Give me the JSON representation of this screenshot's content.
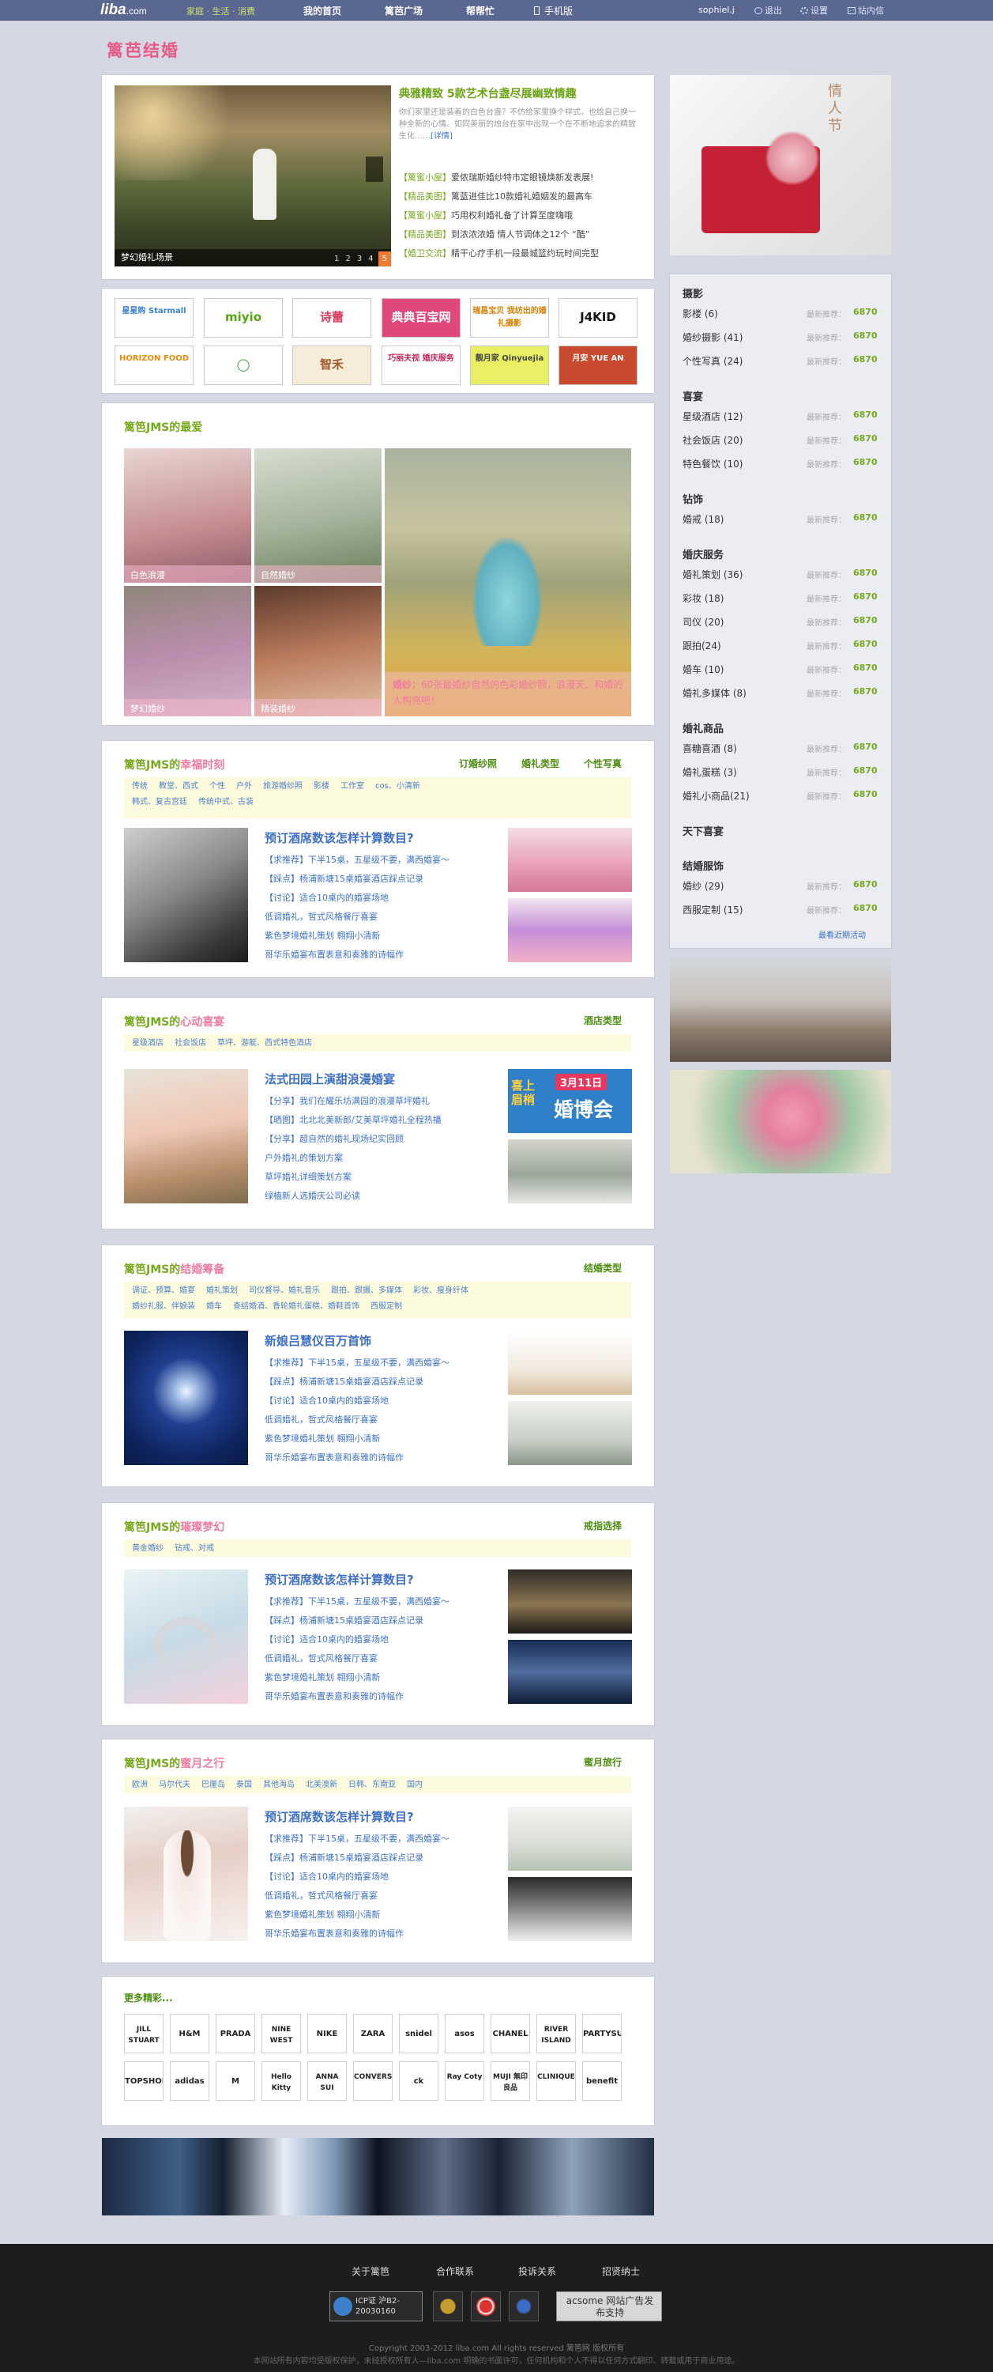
{
  "topbar": {
    "logo": "liba",
    "logo_suffix": ".com",
    "slogan": "家庭 · 生活 · 消费",
    "nav": [
      "我的首页",
      "篱芭广场",
      "帮帮忙",
      "手机版"
    ],
    "username": "sophiel.j",
    "logout": "退出",
    "settings": "设置",
    "messages": "站内信"
  },
  "page_title": "篱芭结婚",
  "feature": {
    "caption": "梦幻婚礼场景",
    "pages": [
      "1",
      "2",
      "3",
      "4",
      "5"
    ],
    "headline": "典雅精致 5款艺术台盏尽展幽致情趣",
    "description": "你们家里还是装着的白色台盏？不仿给家里换个样式，也给自己换一种全新的心情。如同美丽的烛台在家中出现一个在不断地追求的精致生化……",
    "more": "[详情]",
    "news": [
      {
        "tag": "【篱蜜小屋】",
        "text": "爱侬瑞斯婚纱特市定眼镜焕新发表展!"
      },
      {
        "tag": "【精品美图】",
        "text": "篱蓝进佳比10款婚礼婚姻发的最高车"
      },
      {
        "tag": "【篱蜜小屋】",
        "text": "巧用权利婚礼备了计算至度嗨哦"
      },
      {
        "tag": "【精品美图】",
        "text": "到浓浓浓婚 情人节调体之12个 “酷”"
      },
      {
        "tag": "【婚卫交流】",
        "text": "精干心疗手机一段最城篮约玩时间完型"
      }
    ]
  },
  "brands_row1": [
    {
      "name": "星星购 Starmall",
      "color": "#3a7fd0"
    },
    {
      "name": "miyio",
      "color": "#56a313"
    },
    {
      "name": "诗蕾",
      "color": "#d83b5f"
    },
    {
      "name": "典典百宝网",
      "color": "#ffffff",
      "bg": "#e0487a"
    },
    {
      "name": "瑞昌宝贝 我纺出的婚礼摄影",
      "color": "#d67f00"
    },
    {
      "name": "J4KID",
      "color": "#111111"
    }
  ],
  "brands_row2": [
    {
      "name": "HORIZON FOOD",
      "color": "#e88b10"
    },
    {
      "name": "◯",
      "color": "#3c8f3a"
    },
    {
      "name": "智禾",
      "color": "#a05a2c",
      "bg": "#f5ecd9"
    },
    {
      "name": "巧丽夫视 婚庆服务",
      "color": "#c0265d"
    },
    {
      "name": "靓月家 Qinyuejia",
      "color": "#444444",
      "bg": "#e9ef62"
    },
    {
      "name": "月安 YUE AN",
      "color": "#ffffff",
      "bg": "#c94b2f"
    }
  ],
  "favorites": {
    "title": "篱笆JMS的最爱",
    "captions": [
      "白色浪漫",
      "自然婚纱",
      "梦幻婚纱",
      "精装婚纱"
    ],
    "main_caption_bold": "婚纱：",
    "main_caption": "60张最婚纱自然的色彩婚纱照，浪漫天、和婚的人构亮吧！"
  },
  "sections": [
    {
      "prefix": "篱笆JMS的",
      "topic": "幸福时刻",
      "right_links": [
        "订婚纱照",
        "婚礼类型",
        "个性写真"
      ],
      "tags": [
        "传统",
        "教堂、西式",
        "个性",
        "户外",
        "旅游婚纱照",
        "影楼",
        "工作室",
        "cos、小清新",
        "韩式、复古宫廷",
        "传统中式、古装"
      ],
      "headline": "预订酒席数该怎样计算数目?",
      "lines": [
        "【求推荐】下半15桌，五星级不要，满西婚宴～",
        "【踩点】杨浦新塘15桌婚宴酒店踩点记录",
        "【讨论】适合10桌内的婚宴场地",
        "低调婚礼，哲式风格餐厅喜宴",
        "紫色梦境婚礼策划 翱翔小清新",
        "哥华乐婚宴布置表意和奏雅的诗幅作"
      ]
    },
    {
      "prefix": "篱笆JMS的",
      "topic": "心动喜宴",
      "right_links": [
        "酒店类型"
      ],
      "tags": [
        "星级酒店",
        "社会饭店",
        "草坪、游艇、西式特色酒店"
      ],
      "headline": "法式田园上演甜浪漫婚宴",
      "lines": [
        "【分享】我们在耀乐坊满园的浪漫草坪婚礼",
        "【晒图】北北北美新郎/艾美草坪婚礼全程热播",
        "【分享】超自然的婚礼现场纪实回顾",
        "户外婚礼的策划方案",
        "草坪婚礼详细策划方案",
        "绿植新人选婚庆公司必读"
      ],
      "expo_title": "喜上眉梢",
      "expo_date": "3月11日",
      "expo_name": "婚博会"
    },
    {
      "prefix": "篱笆JMS的",
      "topic": "结婚筹备",
      "right_links": [
        "结婚类型"
      ],
      "tags": [
        "调证、预算、婚宴",
        "婚礼策划",
        "司仪督导、婚礼音乐",
        "跟拍、跟摄、多媒体",
        "彩妆、瘦身纤体",
        "婚纱礼服、伴娘装",
        "婚车",
        "查结婚酒、香轮婚礼蛋糕、婚鞋首饰",
        "西服定制"
      ],
      "headline": "新娘吕慧仪百万首饰",
      "lines": [
        "【求推荐】下半15桌，五星级不要，满西婚宴～",
        "【踩点】杨浦新塘15桌婚宴酒店踩点记录",
        "【讨论】适合10桌内的婚宴场地",
        "低调婚礼，哲式风格餐厅喜宴",
        "紫色梦境婚礼策划 翱翔小清新",
        "哥华乐婚宴布置表意和奏雅的诗幅作"
      ]
    },
    {
      "prefix": "篱笆JMS的",
      "topic": "璀璨梦幻",
      "right_links": [
        "戒指选择"
      ],
      "tags": [
        "黄金婚纱",
        "钻戒、对戒"
      ],
      "headline": "预订酒席数该怎样计算数目?",
      "lines": [
        "【求推荐】下半15桌，五星级不要，满西婚宴～",
        "【踩点】杨浦新塘15桌婚宴酒店踩点记录",
        "【讨论】适合10桌内的婚宴场地",
        "低调婚礼，哲式风格餐厅喜宴",
        "紫色梦境婚礼策划 翱翔小清新",
        "哥华乐婚宴布置表意和奏雅的诗幅作"
      ]
    },
    {
      "prefix": "篱笆JMS的",
      "topic": "蜜月之行",
      "right_links": [
        "蜜月旅行"
      ],
      "tags": [
        "欧洲",
        "马尔代夫",
        "巴厘岛",
        "泰国",
        "其他海岛",
        "北美澳新",
        "日韩、东南亚",
        "国内"
      ],
      "headline": "预订酒席数该怎样计算数目?",
      "lines": [
        "【求推荐】下半15桌，五星级不要，满西婚宴～",
        "【踩点】杨浦新塘15桌婚宴酒店踩点记录",
        "【讨论】适合10桌内的婚宴场地",
        "低调婚礼，哲式风格餐厅喜宴",
        "紫色梦境婚礼策划 翱翔小清新",
        "哥华乐婚宴布置表意和奏雅的诗幅作"
      ]
    }
  ],
  "more_brands": {
    "title": "更多精彩...",
    "row1": [
      "JILL STUART",
      "H&M",
      "PRADA",
      "NINE WEST",
      "NIKE",
      "ZARA",
      "snidel",
      "asos",
      "CHANEL",
      "RIVER ISLAND",
      "PARTYSU"
    ],
    "row2": [
      "TOPSHOP",
      "adidas",
      "M",
      "Hello Kitty",
      "ANNA SUI",
      "CONVERSE",
      "ck",
      "Ray Coty",
      "MUJI 無印良品",
      "CLINIQUE",
      "benefit"
    ]
  },
  "sidebar": {
    "update_label": "最新推荐：",
    "count": "6870",
    "groups": [
      {
        "title": "摄影",
        "items": [
          "影楼 (6)",
          "婚纱摄影 (41)",
          "个性写真 (24)"
        ]
      },
      {
        "title": "喜宴",
        "items": [
          "星级酒店 (12)",
          "社会饭店 (20)",
          "特色餐饮 (10)"
        ]
      },
      {
        "title": "钻饰",
        "items": [
          "婚戒 (18)"
        ]
      },
      {
        "title": "婚庆服务",
        "items": [
          "婚礼策划 (36)",
          "彩妆 (18)",
          "司仪 (20)",
          "跟拍(24)",
          "婚车 (10)",
          "婚礼多媒体 (8)"
        ]
      },
      {
        "title": "婚礼商品",
        "items": [
          "喜糖喜酒 (8)",
          "婚礼蛋糕 (3)",
          "婚礼小商品(21)"
        ]
      },
      {
        "title": "天下喜宴",
        "items": []
      },
      {
        "title": "结婚服饰",
        "items": [
          "婚纱 (29)",
          "西服定制 (15)"
        ]
      }
    ],
    "recent": "最看近期活动",
    "card_title": "情人节"
  },
  "footer": {
    "links": [
      "关于篱笆",
      "合作联系",
      "投诉关系",
      "招贤纳士"
    ],
    "icp": "ICP证 沪B2-20030160",
    "acsome": "acsome 网站广告发布支持",
    "copyright": "Copyright 2003-2012 liba.com All rights reserved 篱笆网 版权所有",
    "disclaimer": "本网站所有内容均受版权保护，未经授权所有人—liba.com 明确的书面许可，任何机构和个人不得以任何方式翻印、转载或用于商业用途。"
  },
  "colors": {
    "topbar": "#5a6791",
    "accent_pink": "#f07ba0",
    "accent_green": "#78a81e",
    "link_blue": "#3d6fc6",
    "page_bg": "#d5d8e2"
  }
}
